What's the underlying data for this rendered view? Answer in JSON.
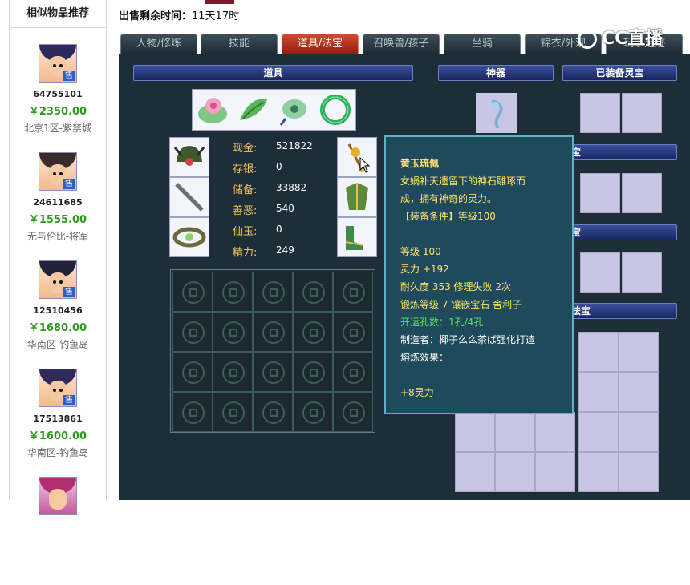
{
  "sidebar": {
    "title": "相似物品推荐",
    "items": [
      {
        "id": "64755101",
        "price": "￥2350.00",
        "server": "北京1区-紫禁城",
        "tag": "售"
      },
      {
        "id": "24611685",
        "price": "￥1555.00",
        "server": "无与伦比-将军",
        "tag": "售"
      },
      {
        "id": "12510456",
        "price": "￥1680.00",
        "server": "华南区-钓鱼岛",
        "tag": "售"
      },
      {
        "id": "17513861",
        "price": "￥1600.00",
        "server": "华南区-钓鱼岛",
        "tag": "售"
      }
    ]
  },
  "header": {
    "sale_time_label": "出售剩余时间：",
    "sale_time_value": "11天17时"
  },
  "tabs": [
    {
      "label": "人物/修炼",
      "active": false
    },
    {
      "label": "技能",
      "active": false
    },
    {
      "label": "道具/法宝",
      "active": true
    },
    {
      "label": "召唤兽/孩子",
      "active": false
    },
    {
      "label": "坐骑",
      "active": false
    },
    {
      "label": "锦衣/外观",
      "active": false
    },
    {
      "label": "玩家足迹",
      "active": false
    }
  ],
  "watermark": "CC直播",
  "sections": {
    "items": "道具",
    "artifact": "神器",
    "equipped_treasure": "已装备灵宝",
    "partial_1": "宝",
    "partial_2": "宝",
    "partial_3": "法宝"
  },
  "stats": [
    {
      "label": "现金:",
      "value": "521822"
    },
    {
      "label": "存银:",
      "value": "0"
    },
    {
      "label": "储备:",
      "value": "33882"
    },
    {
      "label": "善恶:",
      "value": "540"
    },
    {
      "label": "仙玉:",
      "value": "0"
    },
    {
      "label": "精力:",
      "value": "249"
    }
  ],
  "tooltip": {
    "name": "黄玉琉佩",
    "desc1": "女娲补天遗留下的神石雕琢而",
    "desc2": "成，拥有神奇的灵力。",
    "requirement": "【装备条件】等级100",
    "level": "等级 100",
    "spirit": "灵力 +192",
    "durability": "耐久度 353 修理失败 2次",
    "forge": "锻炼等级 7 镶嵌宝石 舍利子",
    "holes": "开运孔数：1孔/4孔",
    "maker": "制造者：椰子么么茶ば强化打造",
    "melt": "熔炼效果：",
    "melt_bonus": "+8灵力"
  },
  "colors": {
    "panel_bg": "#1d2e38",
    "active_tab": "#c43a22",
    "tooltip_bg": "#1e4a5c",
    "price_green": "#2e9a1e"
  }
}
